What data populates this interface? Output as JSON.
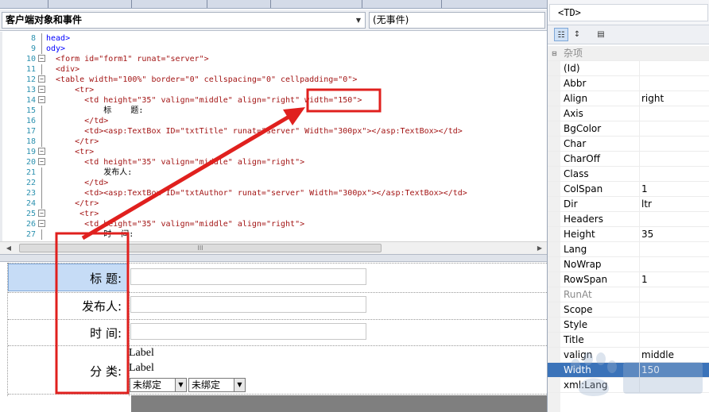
{
  "object_bar": {
    "left_combo": "客户端对象和事件",
    "right_combo": "(无事件)"
  },
  "code_lines": [
    {
      "num": "8",
      "text": "head>",
      "style": "blue"
    },
    {
      "num": "9",
      "text": "ody>",
      "style": "blue"
    },
    {
      "num": "10",
      "text": "  <form id=\"form1\" runat=\"server\">",
      "style": "red"
    },
    {
      "num": "11",
      "text": "  <div>",
      "style": "red"
    },
    {
      "num": "12",
      "text": "  <table width=\"100%\" border=\"0\" cellspacing=\"0\" cellpadding=\"0\">",
      "style": "red"
    },
    {
      "num": "13",
      "text": "      <tr>",
      "style": "red"
    },
    {
      "num": "14",
      "text": "        <td height=\"35\" valign=\"middle\" align=\"right\" width=\"150\">",
      "style": "red"
    },
    {
      "num": "15",
      "text": "            标    题:",
      "style": "black"
    },
    {
      "num": "16",
      "text": "        </td>",
      "style": "red"
    },
    {
      "num": "17",
      "text": "        <td><asp:TextBox ID=\"txtTitle\" runat=\"server\" Width=\"300px\"></asp:TextBox></td>",
      "style": "red"
    },
    {
      "num": "18",
      "text": "      </tr>",
      "style": "red"
    },
    {
      "num": "19",
      "text": "      <tr>",
      "style": "red"
    },
    {
      "num": "20",
      "text": "        <td height=\"35\" valign=\"middle\" align=\"right\">",
      "style": "red"
    },
    {
      "num": "21",
      "text": "            发布人:",
      "style": "black"
    },
    {
      "num": "22",
      "text": "        </td>",
      "style": "red"
    },
    {
      "num": "23",
      "text": "        <td><asp:TextBox ID=\"txtAuthor\" runat=\"server\" Width=\"300px\"></asp:TextBox></td>",
      "style": "red"
    },
    {
      "num": "24",
      "text": "      </tr>",
      "style": "red"
    },
    {
      "num": "25",
      "text": "       <tr>",
      "style": "red"
    },
    {
      "num": "26",
      "text": "        <td height=\"35\" valign=\"middle\" align=\"right\">",
      "style": "red"
    },
    {
      "num": "27",
      "text": "            时  间:",
      "style": "black"
    }
  ],
  "scrollbar": {
    "thumb": "III"
  },
  "design": {
    "row1_label": "标 题:",
    "row2_label": "发布人:",
    "row3_label": "时 间:",
    "row4_label": "分 类:",
    "label1": "Label",
    "label2": "Label",
    "select1": "未绑定",
    "select2": "未绑定"
  },
  "props": {
    "selector": "<TD>",
    "category": "杂项",
    "rows": [
      {
        "name": "(Id)",
        "value": ""
      },
      {
        "name": "Abbr",
        "value": ""
      },
      {
        "name": "Align",
        "value": "right"
      },
      {
        "name": "Axis",
        "value": ""
      },
      {
        "name": "BgColor",
        "value": ""
      },
      {
        "name": "Char",
        "value": ""
      },
      {
        "name": "CharOff",
        "value": ""
      },
      {
        "name": "Class",
        "value": ""
      },
      {
        "name": "ColSpan",
        "value": "1"
      },
      {
        "name": "Dir",
        "value": "ltr"
      },
      {
        "name": "Headers",
        "value": ""
      },
      {
        "name": "Height",
        "value": "35"
      },
      {
        "name": "Lang",
        "value": ""
      },
      {
        "name": "NoWrap",
        "value": ""
      },
      {
        "name": "RowSpan",
        "value": "1"
      },
      {
        "name": "RunAt",
        "value": "",
        "muted": true
      },
      {
        "name": "Scope",
        "value": ""
      },
      {
        "name": "Style",
        "value": ""
      },
      {
        "name": "Title",
        "value": ""
      },
      {
        "name": "valign",
        "value": "middle"
      },
      {
        "name": "Width",
        "value": "150",
        "highlight": true
      },
      {
        "name": "xml:Lang",
        "value": ""
      }
    ]
  },
  "colors": {
    "annotation": "#e0201e",
    "selection": "#c6dcf6",
    "highlight_row": "#3b73b9"
  }
}
